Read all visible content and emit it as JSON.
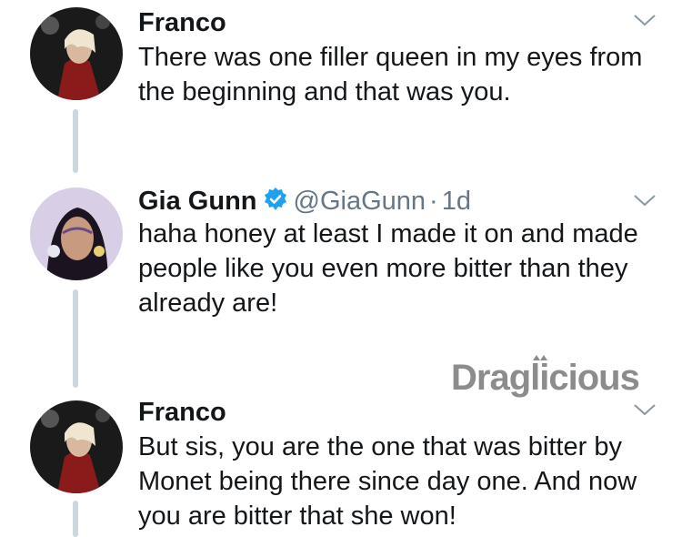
{
  "tweets": [
    {
      "name": "Franco",
      "handle": "",
      "time": "",
      "text": "There was one filler queen in my eyes from the beginning and that was you.",
      "avatar_icon": "franco-avatar",
      "menu_icon": "chevron-down-icon"
    },
    {
      "name": "Gia Gunn",
      "handle": "@GiaGunn",
      "separator": "·",
      "time": "1d",
      "verified_icon": "verified-badge-icon",
      "text": "haha honey at least I made it on and made people like you even more bitter than they already are!",
      "avatar_icon": "gia-gunn-avatar",
      "menu_icon": "chevron-down-icon"
    },
    {
      "name": "Franco",
      "handle": "",
      "time": "",
      "text": "But sis, you are the one that was bitter by Monet being there since day one. And now you are bitter that she won!",
      "avatar_icon": "franco-avatar",
      "menu_icon": "chevron-down-icon"
    }
  ],
  "watermark": {
    "text": "Draglicious"
  },
  "colors": {
    "text": "#14171a",
    "meta": "#657786",
    "verified": "#1da1f2",
    "thread_line": "#ccd6dd",
    "watermark": "#8c8c8c"
  }
}
